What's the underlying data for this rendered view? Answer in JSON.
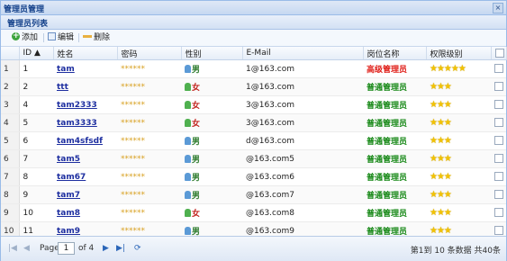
{
  "window": {
    "title": "管理员管理",
    "close": "×"
  },
  "panel": {
    "title": "管理员列表"
  },
  "toolbar": {
    "add": "添加",
    "edit": "编辑",
    "delete": "删除"
  },
  "columns": [
    "ID ▲",
    "姓名",
    "密码",
    "性别",
    "E-Mail",
    "岗位名称",
    "权限级别"
  ],
  "rows": [
    {
      "rn": "1",
      "id": "1",
      "name": "tam",
      "pwd": "******",
      "gender": "男",
      "gclass": "m",
      "email": "1@163.com",
      "role": "高级管理员",
      "rclass": "senior",
      "stars": "★★★★★"
    },
    {
      "rn": "2",
      "id": "2",
      "name": "ttt",
      "pwd": "******",
      "gender": "女",
      "gclass": "f",
      "email": "1@163.com",
      "role": "普通管理员",
      "rclass": "normal",
      "stars": "★★★"
    },
    {
      "rn": "3",
      "id": "4",
      "name": "tam2333",
      "pwd": "******",
      "gender": "女",
      "gclass": "f",
      "email": "3@163.com",
      "role": "普通管理员",
      "rclass": "normal",
      "stars": "★★★"
    },
    {
      "rn": "4",
      "id": "5",
      "name": "tam3333",
      "pwd": "******",
      "gender": "女",
      "gclass": "f",
      "email": "3@163.com",
      "role": "普通管理员",
      "rclass": "normal",
      "stars": "★★★"
    },
    {
      "rn": "5",
      "id": "6",
      "name": "tam4sfsdf",
      "pwd": "******",
      "gender": "男",
      "gclass": "m",
      "email": "d@163.com",
      "role": "普通管理员",
      "rclass": "normal",
      "stars": "★★★"
    },
    {
      "rn": "6",
      "id": "7",
      "name": "tam5",
      "pwd": "******",
      "gender": "男",
      "gclass": "m",
      "email": "@163.com5",
      "role": "普通管理员",
      "rclass": "normal",
      "stars": "★★★"
    },
    {
      "rn": "7",
      "id": "8",
      "name": "tam67",
      "pwd": "******",
      "gender": "男",
      "gclass": "m",
      "email": "@163.com6",
      "role": "普通管理员",
      "rclass": "normal",
      "stars": "★★★"
    },
    {
      "rn": "8",
      "id": "9",
      "name": "tam7",
      "pwd": "******",
      "gender": "男",
      "gclass": "m",
      "email": "@163.com7",
      "role": "普通管理员",
      "rclass": "normal",
      "stars": "★★★"
    },
    {
      "rn": "9",
      "id": "10",
      "name": "tam8",
      "pwd": "******",
      "gender": "女",
      "gclass": "f",
      "email": "@163.com8",
      "role": "普通管理员",
      "rclass": "normal",
      "stars": "★★★"
    },
    {
      "rn": "10",
      "id": "11",
      "name": "tam9",
      "pwd": "******",
      "gender": "男",
      "gclass": "m",
      "email": "@163.com9",
      "role": "普通管理员",
      "rclass": "normal",
      "stars": "★★★"
    }
  ],
  "pager": {
    "page_label": "Page",
    "page_value": "1",
    "of_label": "of 4",
    "first": "|◀",
    "prev": "◀",
    "next": "▶",
    "last": "▶|",
    "refresh": "⟳",
    "info": "第1到 10 条数据 共40条"
  },
  "colors": {
    "accent": "#15428b",
    "senior": "#e0201a",
    "normal": "#1a8a1a",
    "star": "#f2c200"
  },
  "icons": {
    "add": "add-icon",
    "edit": "edit-icon",
    "delete": "delete-icon",
    "male": "male-user-icon",
    "female": "female-user-icon",
    "star": "star-icon"
  }
}
